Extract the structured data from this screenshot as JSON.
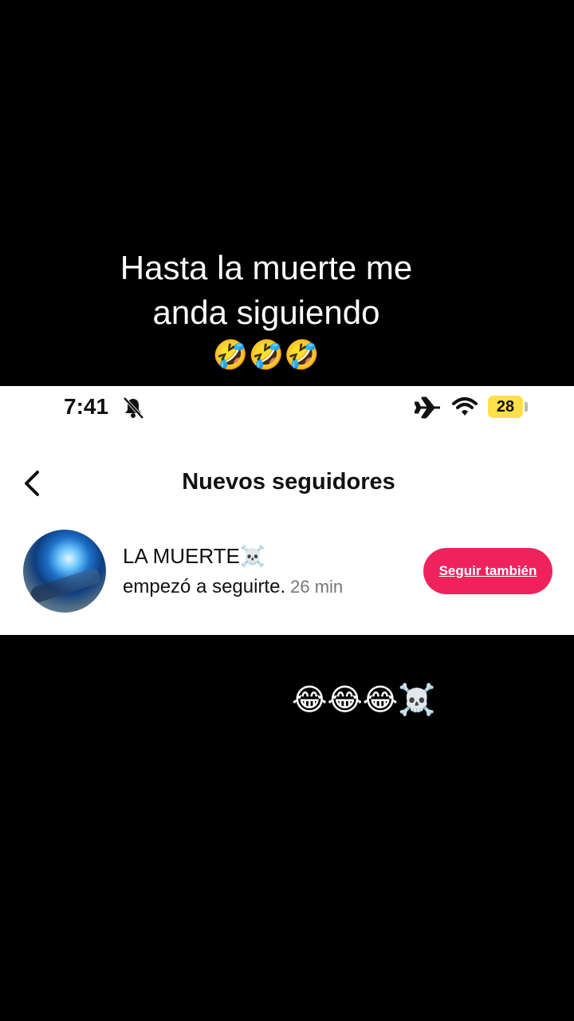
{
  "caption": {
    "line1": "Hasta la muerte me",
    "line2": "anda siguiendo",
    "emojis": "🤣🤣🤣"
  },
  "statusbar": {
    "time": "7:41",
    "battery": "28",
    "icons": [
      "bell-muted-icon",
      "airplane-icon",
      "wifi-icon",
      "battery-icon"
    ]
  },
  "header": {
    "title": "Nuevos seguidores",
    "back_icon": "chevron-left-icon"
  },
  "follower": {
    "name": "LA MUERTE",
    "name_emoji": "☠️",
    "activity": "empezó a seguirte.",
    "time_ago": "26 min",
    "button_label": "Seguir también",
    "button_color": "#f0225e"
  },
  "bottom": {
    "emojis": "😂😂😂☠️"
  }
}
